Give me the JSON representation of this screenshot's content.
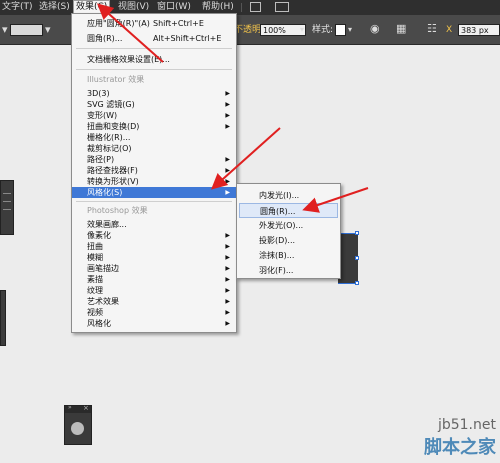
{
  "menubar": {
    "items": [
      {
        "label": "文字(T)"
      },
      {
        "label": "选择(S)"
      },
      {
        "label": "效果(C)"
      },
      {
        "label": "视图(V)"
      },
      {
        "label": "窗口(W)"
      },
      {
        "label": "帮助(H)"
      }
    ]
  },
  "controlbar": {
    "opacity_label": "不透明度",
    "opacity_value": "100%",
    "style_label": "样式:",
    "width_value": "383 px"
  },
  "effect_menu": {
    "items_top": [
      {
        "label": "应用\"圆角(R)\"(A)",
        "shortcut": "Shift+Ctrl+E"
      },
      {
        "label": "圆角(R)...",
        "shortcut": "Alt+Shift+Ctrl+E"
      }
    ],
    "raster_settings": "文档栅格效果设置(E)...",
    "section_illustrator": "Illustrator 效果",
    "illustrator_items": [
      {
        "label": "3D(3)",
        "submenu": true
      },
      {
        "label": "SVG 滤镜(G)",
        "submenu": true
      },
      {
        "label": "变形(W)",
        "submenu": true
      },
      {
        "label": "扭曲和变换(D)",
        "submenu": true
      },
      {
        "label": "栅格化(R)...",
        "submenu": false
      },
      {
        "label": "裁剪标记(O)",
        "submenu": false
      },
      {
        "label": "路径(P)",
        "submenu": true
      },
      {
        "label": "路径查找器(F)",
        "submenu": true
      },
      {
        "label": "转换为形状(V)",
        "submenu": true
      },
      {
        "label": "风格化(S)",
        "submenu": true,
        "highlighted": true
      }
    ],
    "section_photoshop": "Photoshop 效果",
    "photoshop_items": [
      {
        "label": "效果画廊...",
        "submenu": false
      },
      {
        "label": "像素化",
        "submenu": true
      },
      {
        "label": "扭曲",
        "submenu": true
      },
      {
        "label": "模糊",
        "submenu": true
      },
      {
        "label": "画笔描边",
        "submenu": true
      },
      {
        "label": "素描",
        "submenu": true
      },
      {
        "label": "纹理",
        "submenu": true
      },
      {
        "label": "艺术效果",
        "submenu": true
      },
      {
        "label": "视频",
        "submenu": true
      },
      {
        "label": "风格化",
        "submenu": true
      }
    ]
  },
  "stylize_submenu": {
    "items": [
      {
        "label": "内发光(I)..."
      },
      {
        "label": "圆角(R)...",
        "highlighted": true
      },
      {
        "label": "外发光(O)..."
      },
      {
        "label": "投影(D)..."
      },
      {
        "label": "涂抹(B)..."
      },
      {
        "label": "羽化(F)..."
      }
    ]
  },
  "watermark": {
    "site": "jb51.net",
    "name": "脚本之家"
  },
  "colors": {
    "menu_highlight": "#3f78d6",
    "annotation_arrow": "#e02020",
    "selection_blue": "#2f6fd6"
  }
}
